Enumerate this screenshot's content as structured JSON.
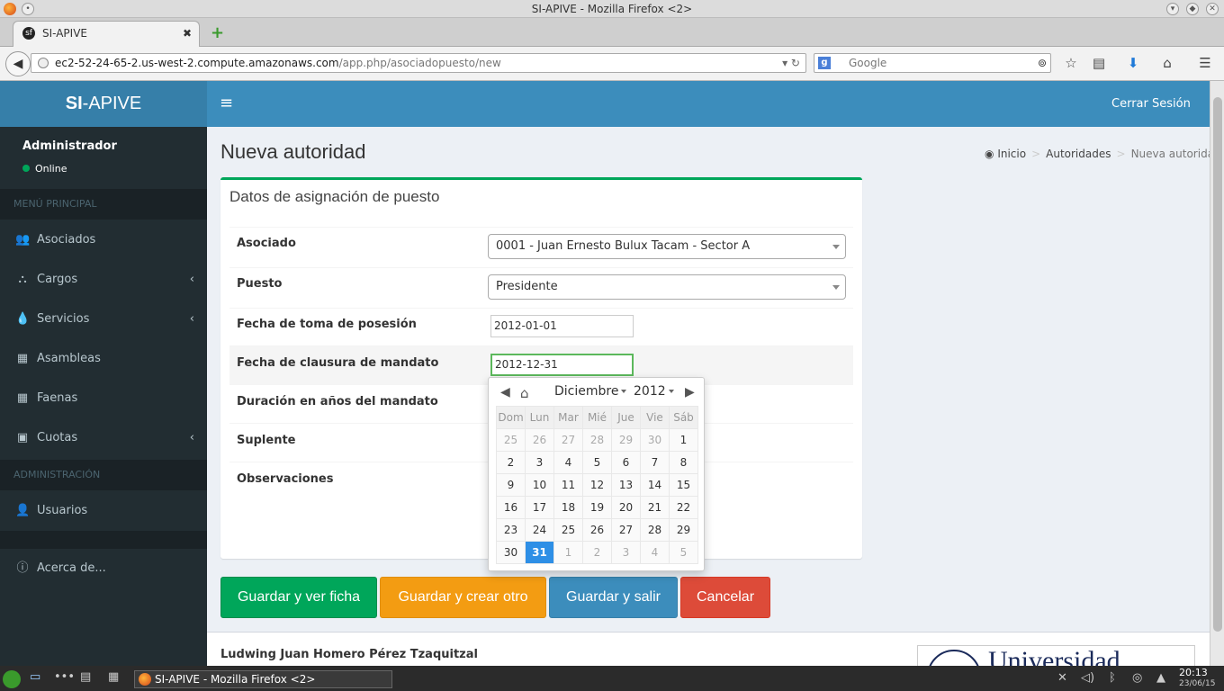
{
  "window": {
    "title": "SI-APIVE - Mozilla Firefox <2>"
  },
  "tab": {
    "title": "SI-APIVE",
    "close": "✖",
    "new": "+"
  },
  "nav": {
    "url_host": "ec2-52-24-65-2.us-west-2.compute.amazonaws.com",
    "url_path": "/app.php/asociadopuesto/new",
    "search_placeholder": "Google"
  },
  "brand": {
    "prefix": "SI",
    "suffix": "-APIVE"
  },
  "user": {
    "name": "Administrador",
    "status": "Online"
  },
  "sidebar": {
    "section_main": "MENÚ PRINCIPAL",
    "section_admin": "ADMINISTRACIÓN",
    "items": [
      {
        "label": "Asociados",
        "icon": "users-icon"
      },
      {
        "label": "Cargos",
        "icon": "sitemap-icon"
      },
      {
        "label": "Servicios",
        "icon": "drop-icon"
      },
      {
        "label": "Asambleas",
        "icon": "calendar-icon"
      },
      {
        "label": "Faenas",
        "icon": "calendar-icon"
      },
      {
        "label": "Cuotas",
        "icon": "money-icon"
      },
      {
        "label": "Usuarios",
        "icon": "user-icon"
      },
      {
        "label": "Acerca de...",
        "icon": "info-icon"
      }
    ]
  },
  "header": {
    "logout": "Cerrar Sesión"
  },
  "page": {
    "title": "Nueva autoridad"
  },
  "breadcrumb": {
    "home": "Inicio",
    "parent": "Autoridades",
    "current": "Nueva autoridad"
  },
  "form": {
    "title": "Datos de asignación de puesto",
    "asociado_label": "Asociado",
    "asociado_value": "0001 - Juan Ernesto Bulux Tacam - Sector A",
    "puesto_label": "Puesto",
    "puesto_value": "Presidente",
    "fecha_toma_label": "Fecha de toma de posesión",
    "fecha_toma_value": "2012-01-01",
    "fecha_clausura_label": "Fecha de clausura de mandato",
    "fecha_clausura_value": "2012-12-31",
    "duracion_label": "Duración en años del mandato",
    "suplente_label": "Suplente",
    "observaciones_label": "Observaciones"
  },
  "buttons": {
    "save_view": "Guardar y ver ficha",
    "save_new": "Guardar y crear otro",
    "save_exit": "Guardar y salir",
    "cancel": "Cancelar",
    "colors": {
      "green": "#00a65a",
      "orange": "#f39c12",
      "blue": "#3c8dbc",
      "red": "#dd4b39"
    }
  },
  "datepicker": {
    "month": "Diciembre",
    "year": "2012",
    "weekdays": [
      "Dom",
      "Lun",
      "Mar",
      "Mié",
      "Jue",
      "Vie",
      "Sáb"
    ],
    "weeks": [
      [
        "25",
        "26",
        "27",
        "28",
        "29",
        "30",
        "1"
      ],
      [
        "2",
        "3",
        "4",
        "5",
        "6",
        "7",
        "8"
      ],
      [
        "9",
        "10",
        "11",
        "12",
        "13",
        "14",
        "15"
      ],
      [
        "16",
        "17",
        "18",
        "19",
        "20",
        "21",
        "22"
      ],
      [
        "23",
        "24",
        "25",
        "26",
        "27",
        "28",
        "29"
      ],
      [
        "30",
        "31",
        "1",
        "2",
        "3",
        "4",
        "5"
      ]
    ],
    "selected": "31"
  },
  "footer": {
    "author": "Ludwing Juan Homero Pérez Tzaquitzal",
    "logo_text": "Universidad"
  },
  "taskbar": {
    "item": "SI-APIVE - Mozilla Firefox <2>",
    "time": "20:13",
    "date": "23/06/15"
  }
}
